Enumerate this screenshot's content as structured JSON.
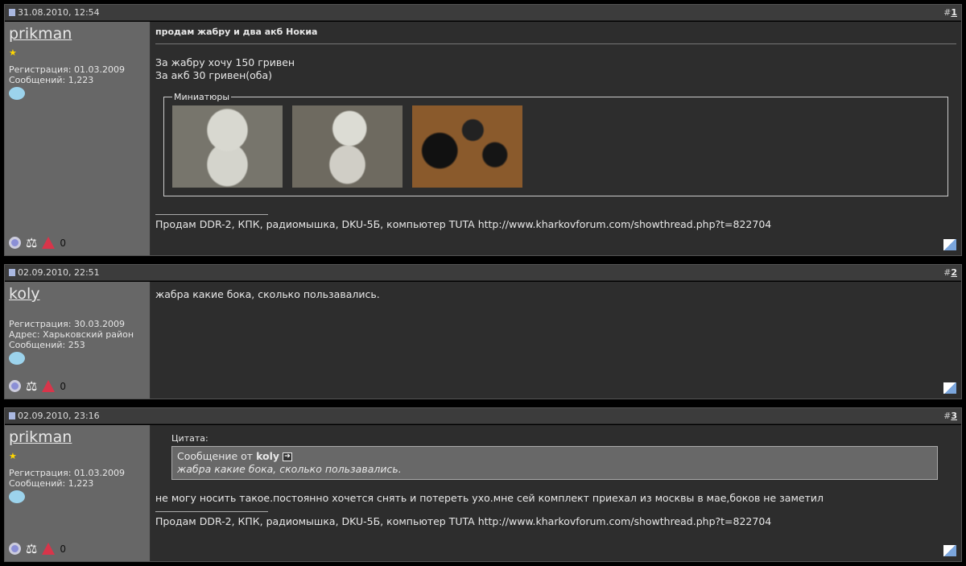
{
  "posts": [
    {
      "date": "31.08.2010, 12:54",
      "number_prefix": "#",
      "number": "1",
      "user": "prikman",
      "rank_icon": "star",
      "registration": "Регистрация: 01.03.2009",
      "address": null,
      "posts_count": "Сообщений: 1,223",
      "title": "продам жабру и два акб Нокиа",
      "lines": [
        "За жабру хочу 150 гривен",
        "За акб 30 гривен(оба)"
      ],
      "attachments_label": "Миниатюры",
      "signature_text": "Продам DDR-2, КПК, радиомышка, DKU-5Б, компьютер TUTA ",
      "signature_link": "http://www.kharkovforum.com/showthread.php?t=822704"
    },
    {
      "date": "02.09.2010, 22:51",
      "number_prefix": "#",
      "number": "2",
      "user": "koly",
      "registration": "Регистрация: 30.03.2009",
      "address": "Адрес: Харьковский район",
      "posts_count": "Сообщений: 253",
      "message": "жабра какие бока, сколько пользавались."
    },
    {
      "date": "02.09.2010, 23:16",
      "number_prefix": "#",
      "number": "3",
      "user": "prikman",
      "registration": "Регистрация: 01.03.2009",
      "posts_count": "Сообщений: 1,223",
      "quote_label": "Цитата:",
      "quote_from": "Сообщение от ",
      "quote_user": "koly",
      "quote_text": "жабра какие бока, сколько пользавались.",
      "message": "не могу носить такое.постоянно хочется снять и потереть ухо.мне сей комплект приехал из москвы в мае,боков не заметил",
      "signature_text": "Продам DDR-2, КПК, радиомышка, DKU-5Б, компьютер TUTA ",
      "signature_link": "http://www.kharkovforum.com/showthread.php?t=822704"
    }
  ]
}
